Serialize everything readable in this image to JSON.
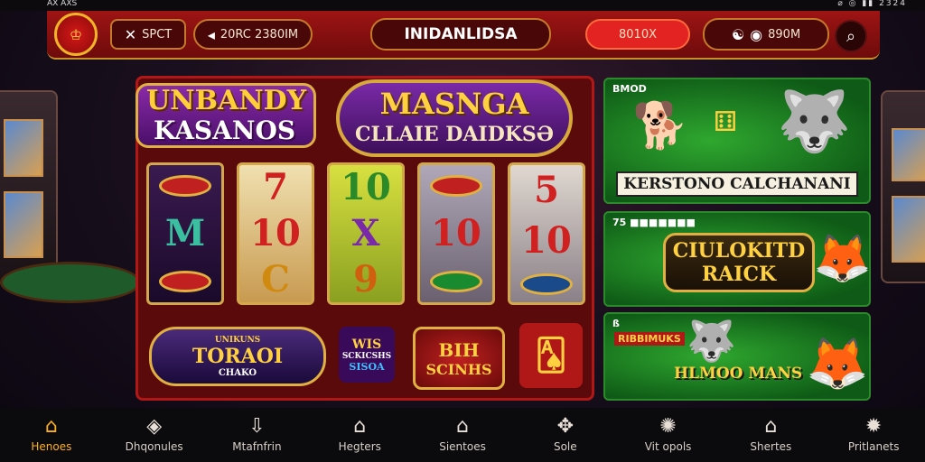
{
  "status_bar": {
    "left": "AX AXS",
    "right": "⌀ ◎ ▮▮ 2324"
  },
  "topbar": {
    "logo_text": "♔",
    "btn1": {
      "icon": "✕",
      "label": "SPCT"
    },
    "btn2": {
      "icon": "◂",
      "label": "20RC 2380IM"
    },
    "title": "INIDANLIDSA",
    "balance": "8010X",
    "account": {
      "icon1": "☯",
      "icon2": "◉",
      "label": "890M"
    },
    "search_icon": "⌕"
  },
  "promo": {
    "badge1_line1": "UNBANDY",
    "badge1_line2": "KASANOS",
    "badge2_line1": "MASNGA",
    "badge2_line2": "CLLAIE DAIDKSƏ"
  },
  "reels": [
    {
      "top": "chip-red",
      "mid": "M",
      "bot": "chip-red"
    },
    {
      "top": "7",
      "mid": "10",
      "bot": "C"
    },
    {
      "top": "10",
      "mid": "X",
      "bot": "9"
    },
    {
      "top": "chip-red",
      "mid": "10",
      "bot": "chip-green"
    },
    {
      "top": "5",
      "mid": "10",
      "bot": "chip-blue"
    }
  ],
  "bottom_badges": {
    "b1_line1": "UNIKUNS",
    "b1_line2": "TORAOI",
    "b1_line3": "CHAKO",
    "b2_line1": "WIS",
    "b2_line2": "SCKICSHS",
    "b2_line3": "SISOA",
    "b3_line1": "BIH",
    "b3_line2": "SCINHS"
  },
  "cards": [
    {
      "small": "BMOD",
      "banner": "KERSTONO CALCHANANI"
    },
    {
      "small": "75 ■■■■■■■",
      "title_line1": "CIULOKITD",
      "title_line2": "RAICK"
    },
    {
      "small": "ß",
      "tag": "RIBBIMUKS",
      "title": "HLMOO MANS"
    }
  ],
  "nav": [
    {
      "icon": "⌂",
      "label": "Henoes",
      "active": true
    },
    {
      "icon": "◈",
      "label": "Dhqonules"
    },
    {
      "icon": "⇩",
      "label": "Mtafnfrin"
    },
    {
      "icon": "⌂",
      "label": "Hegters"
    },
    {
      "icon": "⌂",
      "label": "Sientoes"
    },
    {
      "icon": "✥",
      "label": "Sole"
    },
    {
      "icon": "✺",
      "label": "Vit opols"
    },
    {
      "icon": "⌂",
      "label": "Shertes"
    },
    {
      "icon": "✹",
      "label": "Pritlanets"
    }
  ],
  "colors": {
    "accent": "#ffb020",
    "topbar": "#9e1414",
    "gold": "#d8a93a",
    "card_green": "#2fa82f"
  }
}
